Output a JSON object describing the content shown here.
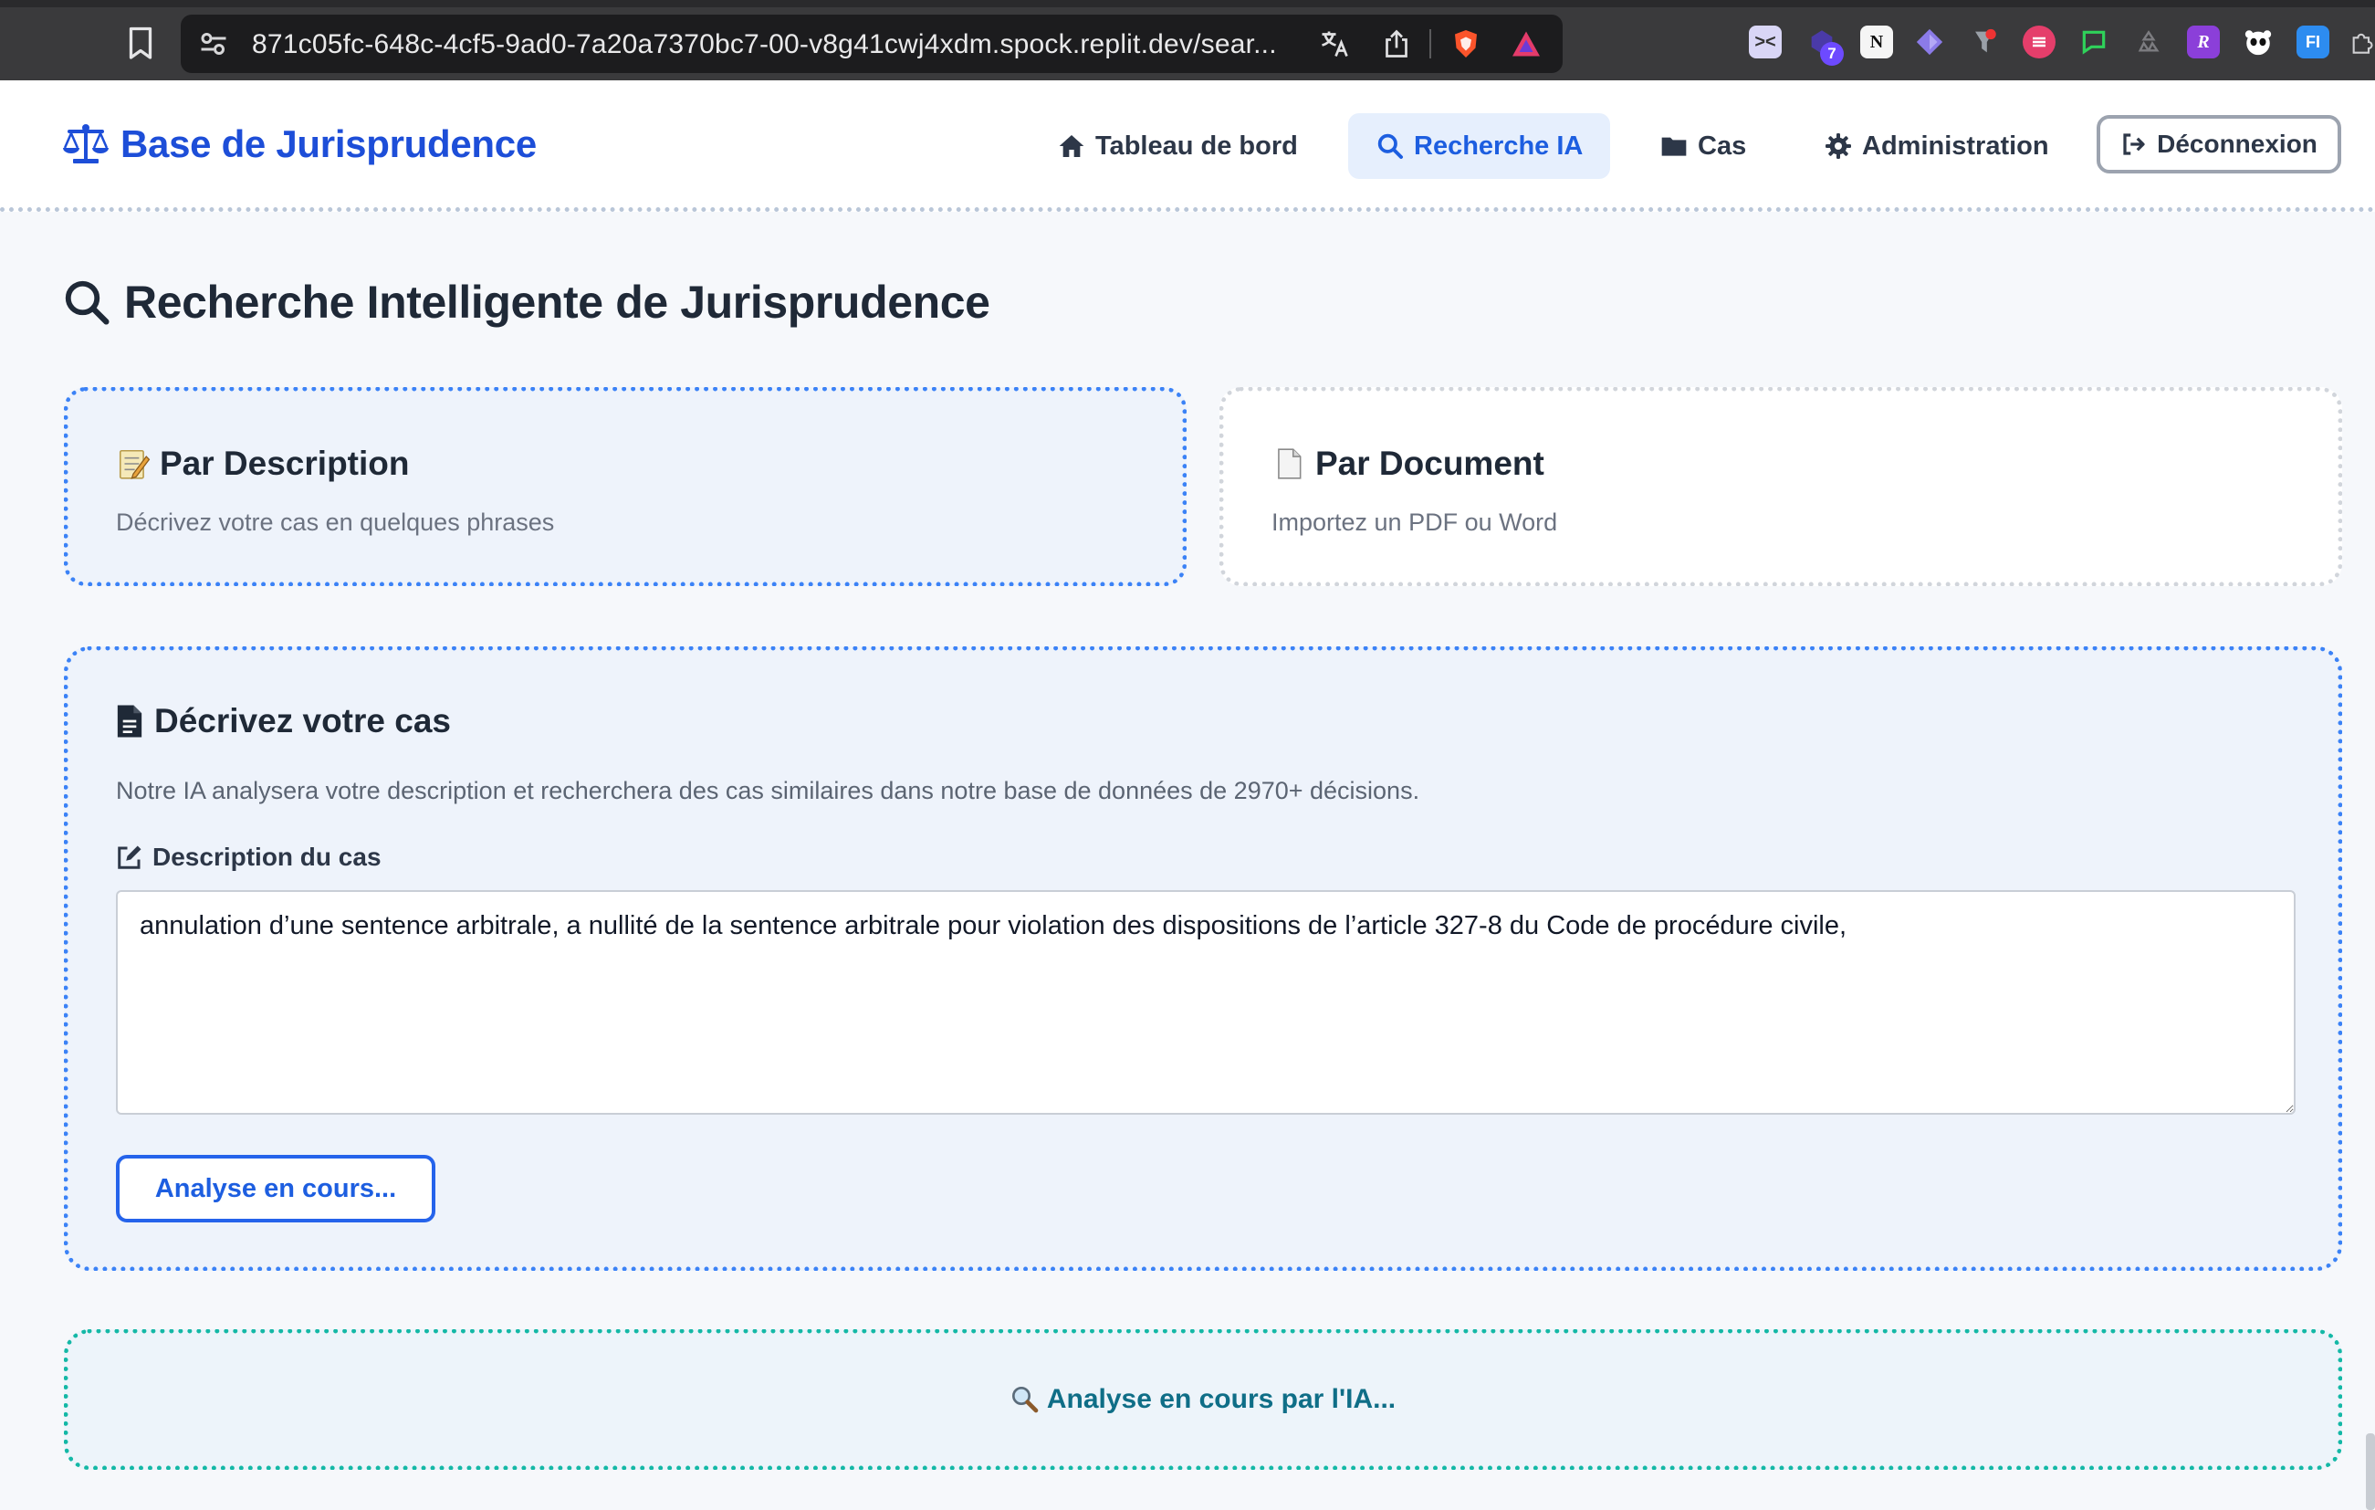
{
  "browser": {
    "url": "871c05fc-648c-4cf5-9ad0-7a20a7370bc7-00-v8g41cwj4xdm.spock.replit.dev/sear...",
    "extension_badge": "7",
    "ext_letter_r": "R",
    "ext_letter_fi": "FI"
  },
  "header": {
    "brand": "Base de Jurisprudence",
    "nav": {
      "dashboard": "Tableau de bord",
      "search": "Recherche IA",
      "cases": "Cas",
      "admin": "Administration"
    },
    "logout": "Déconnexion"
  },
  "page": {
    "title": "Recherche Intelligente de Jurisprudence"
  },
  "modes": {
    "description": {
      "title": "Par Description",
      "subtitle": "Décrivez votre cas en quelques phrases"
    },
    "document": {
      "title": "Par Document",
      "subtitle": "Importez un PDF ou Word"
    }
  },
  "form": {
    "title": "Décrivez votre cas",
    "help": "Notre IA analysera votre description et recherchera des cas similaires dans notre base de données de 2970+ décisions.",
    "field_label": "Description du cas",
    "field_value": "annulation d’une sentence arbitrale, a nullité de la sentence arbitrale pour violation des dispositions de l’article 327-8 du Code de procédure civile,",
    "submit_label": "Analyse en cours..."
  },
  "status": {
    "message": "Analyse en cours par l'IA..."
  },
  "colors": {
    "primary": "#1d4ed8",
    "active_nav_bg": "#e6effd",
    "panel_border": "#3b82f6",
    "status_border": "#14b8a6",
    "status_text": "#0f6e87"
  }
}
